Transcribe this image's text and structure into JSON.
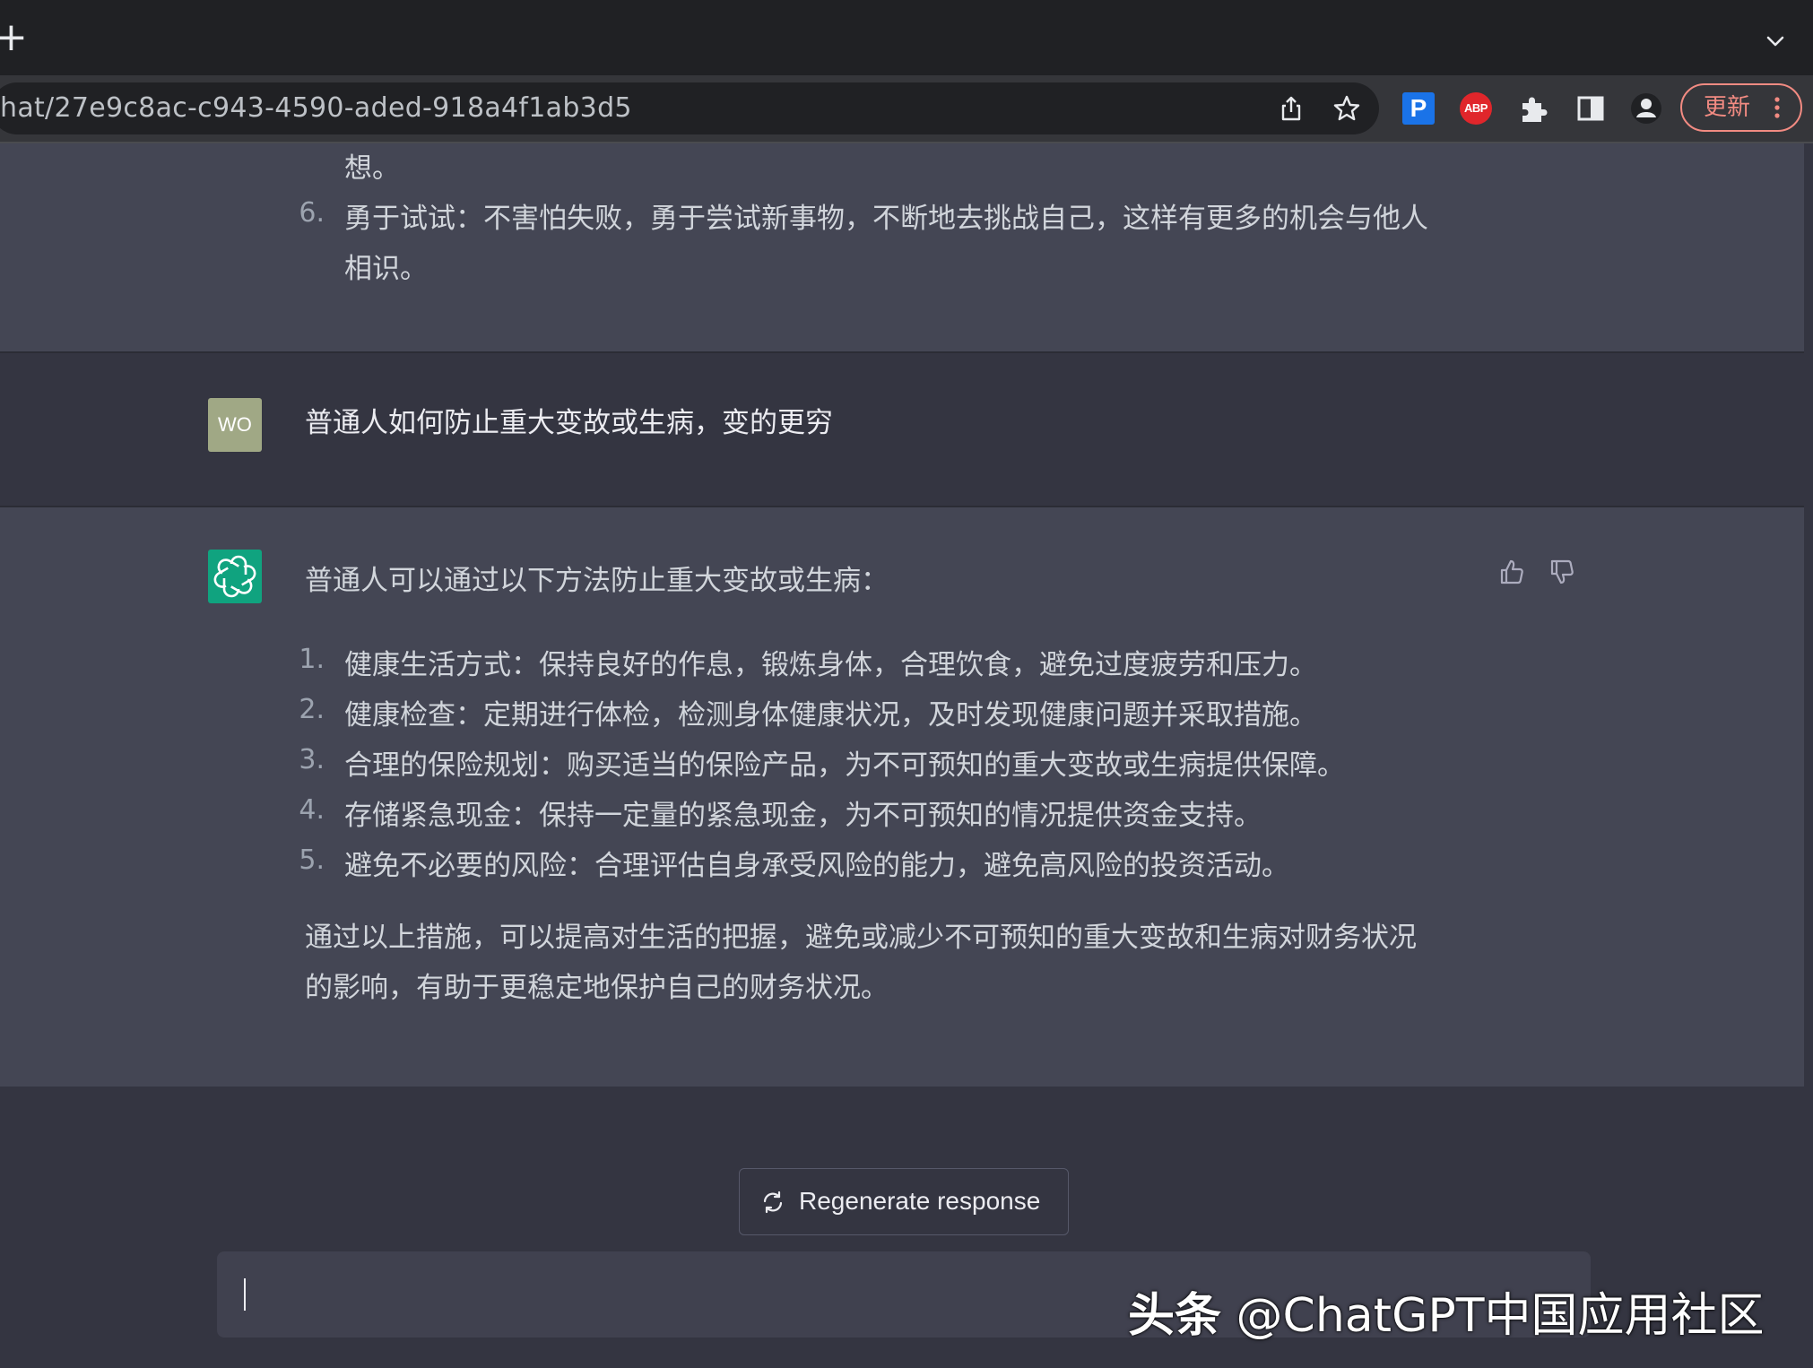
{
  "browser": {
    "new_tab_glyph": "+",
    "url": "hat/27e9c8ac-c943-4590-aded-918a4f1ab3d5",
    "ext_p_label": "P",
    "ext_abp_label": "ABP",
    "update_label": "更新",
    "icons": [
      "plus-icon",
      "chevron-down-icon",
      "share-icon",
      "star-icon",
      "puzzle-icon",
      "side-panel-icon",
      "profile-icon",
      "more-vert-icon"
    ]
  },
  "chat": {
    "prev_answer": {
      "line_tail": "想。",
      "item6_num": "6.",
      "item6_line1": "勇于试试：不害怕失败，勇于尝试新事物，不断地去挑战自己，这样有更多的机会与他人",
      "item6_line2": "相识。"
    },
    "user": {
      "avatar_initials": "WO",
      "message": "普通人如何防止重大变故或生病，变的更穷"
    },
    "assistant": {
      "intro": "普通人可以通过以下方法防止重大变故或生病：",
      "items": [
        {
          "num": "1.",
          "text": "健康生活方式：保持良好的作息，锻炼身体，合理饮食，避免过度疲劳和压力。"
        },
        {
          "num": "2.",
          "text": "健康检查：定期进行体检，检测身体健康状况，及时发现健康问题并采取措施。"
        },
        {
          "num": "3.",
          "text": "合理的保险规划：购买适当的保险产品，为不可预知的重大变故或生病提供保障。"
        },
        {
          "num": "4.",
          "text": "存储紧急现金：保持一定量的紧急现金，为不可预知的情况提供资金支持。"
        },
        {
          "num": "5.",
          "text": "避免不必要的风险：合理评估自身承受风险的能力，避免高风险的投资活动。"
        }
      ],
      "conclusion_line1": "通过以上措施，可以提高对生活的把握，避免或减少不可预知的重大变故和生病对财务状况",
      "conclusion_line2": "的影响，有助于更稳定地保护自己的财务状况。"
    },
    "regenerate_label": "Regenerate response",
    "input_value": ""
  },
  "watermark": {
    "brand": "头条",
    "handle": " @ChatGPT中国应用社区"
  },
  "colors": {
    "page_bg": "#343541",
    "assistant_bg": "#444654",
    "accent_green": "#10a37f",
    "user_avatar": "#a0a885",
    "update_red": "#f28b82"
  }
}
